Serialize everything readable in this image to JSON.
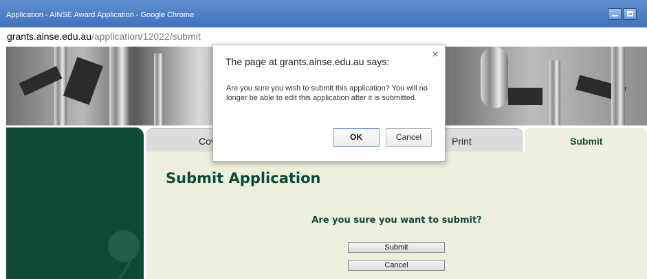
{
  "window": {
    "title": "Application - AINSE Award Application - Google Chrome"
  },
  "address": {
    "host": "grants.ainse.edu.au",
    "path": "/application/12022/submit"
  },
  "tabs": [
    {
      "label": "Cov"
    },
    {
      "label": "Print"
    },
    {
      "label": "Submit"
    }
  ],
  "main": {
    "heading": "Submit Application",
    "question": "Are you sure you want to submit?",
    "submit_label": "Submit",
    "cancel_label": "Cancel"
  },
  "dialog": {
    "title": "The page at grants.ainse.edu.au says:",
    "message": "Are you sure you wish to submit this application? You will no longer be able to edit this application after it is submitted.",
    "ok_label": "OK",
    "cancel_label": "Cancel",
    "close_glyph": "×"
  },
  "colors": {
    "brand_green": "#0d4a37",
    "content_bg": "#eef0dd",
    "titlebar": "#4a7cc4"
  }
}
